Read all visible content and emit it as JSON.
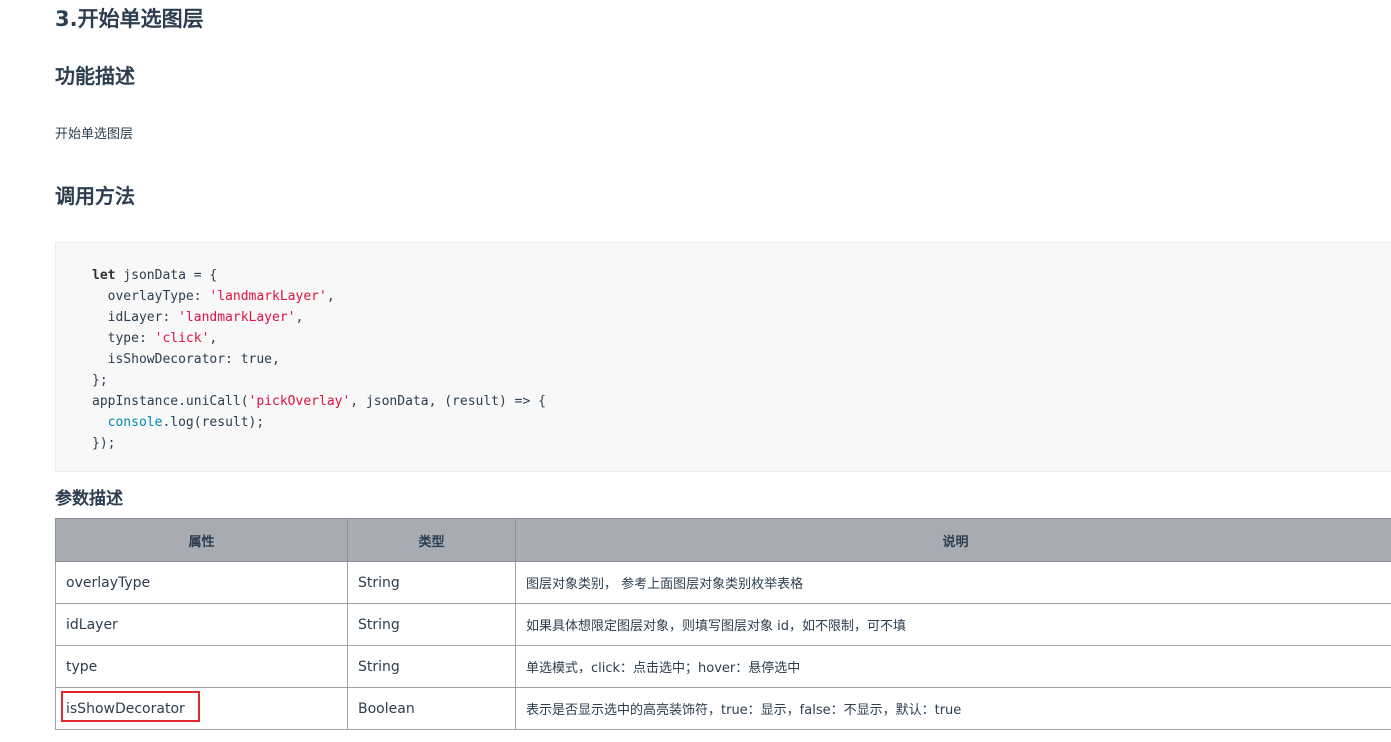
{
  "headings": {
    "main": "3.开始单选图层",
    "function_desc": "功能描述",
    "call_method": "调用方法",
    "params_desc": "参数描述"
  },
  "function_text": "开始单选图层",
  "code": {
    "line1_kw": "let",
    "line1_rest": " jsonData = {",
    "line2_key": "  overlayType: ",
    "line2_val": "'landmarkLayer'",
    "line2_end": ",",
    "line3_key": "  idLayer: ",
    "line3_val": "'landmarkLayer'",
    "line3_end": ",",
    "line4_key": "  type: ",
    "line4_val": "'click'",
    "line4_end": ",",
    "line5": "  isShowDecorator: true,",
    "line6": "};",
    "line7_pre": "appInstance.uniCall(",
    "line7_val": "'pickOverlay'",
    "line7_end": ", jsonData, (result) => {",
    "line8_indent": "  ",
    "line8_fn": "console",
    "line8_rest": ".log(result);",
    "line9": "});"
  },
  "table": {
    "headers": [
      "属性",
      "类型",
      "说明"
    ],
    "rows": [
      {
        "prop": "overlayType",
        "type": "String",
        "desc": "图层对象类别， 参考上面图层对象类别枚举表格"
      },
      {
        "prop": "idLayer",
        "type": "String",
        "desc": "如果具体想限定图层对象，则填写图层对象 id，如不限制，可不填"
      },
      {
        "prop": "type",
        "type": "String",
        "desc": "单选模式，click：点击选中；hover：悬停选中"
      },
      {
        "prop": "isShowDecorator",
        "type": "Boolean",
        "desc": "表示是否显示选中的高亮装饰符，true：显示，false：不显示，默认：true"
      }
    ]
  },
  "colors": {
    "header_bg": "#a9abb3",
    "string_literal": "#d14",
    "highlight_border": "#e0282e"
  }
}
